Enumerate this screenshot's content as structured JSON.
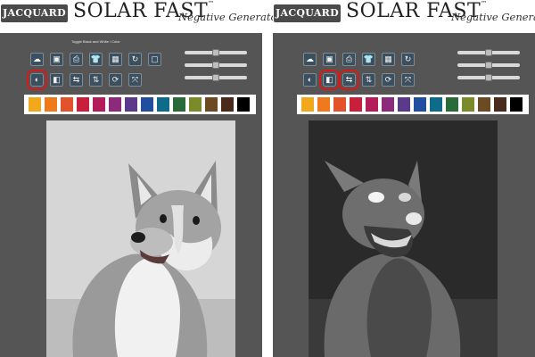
{
  "brand": {
    "logo_text": "JACQUARD",
    "title": "SOLAR FAST",
    "title_tm": "™",
    "subtitle": "Negative Generator"
  },
  "left_panel": {
    "toolbar_caption": "Toggle Black and White / Color",
    "tools_row1": [
      {
        "name": "upload-icon",
        "glyph": "☁"
      },
      {
        "name": "save-icon",
        "glyph": "▣"
      },
      {
        "name": "print-icon",
        "glyph": "⎙"
      },
      {
        "name": "shirt-icon",
        "glyph": "👕"
      },
      {
        "name": "grid-icon",
        "glyph": "▦"
      },
      {
        "name": "reset-icon",
        "glyph": "↻"
      },
      {
        "name": "crop-icon",
        "glyph": "▢"
      }
    ],
    "tools_row2": [
      {
        "name": "bw-color-toggle-icon",
        "glyph": "◐"
      },
      {
        "name": "invert-icon",
        "glyph": "◧"
      },
      {
        "name": "flip-horizontal-icon",
        "glyph": "⇆"
      },
      {
        "name": "flip-vertical-icon",
        "glyph": "⇅"
      },
      {
        "name": "rotate-icon",
        "glyph": "⟳"
      },
      {
        "name": "fit-icon",
        "glyph": "⤧"
      }
    ],
    "highlighted_tools": [
      "bw-color-toggle-icon"
    ],
    "slider_levels": [
      0.5,
      0.5,
      0.5
    ]
  },
  "right_panel": {
    "tools_row1": [
      {
        "name": "upload-icon",
        "glyph": "☁"
      },
      {
        "name": "save-icon",
        "glyph": "▣"
      },
      {
        "name": "print-icon",
        "glyph": "⎙"
      },
      {
        "name": "shirt-icon",
        "glyph": "👕"
      },
      {
        "name": "grid-icon",
        "glyph": "▦"
      },
      {
        "name": "reset-icon",
        "glyph": "↻"
      }
    ],
    "tools_row2": [
      {
        "name": "bw-color-toggle-icon",
        "glyph": "◐"
      },
      {
        "name": "invert-icon",
        "glyph": "◧"
      },
      {
        "name": "flip-horizontal-icon",
        "glyph": "⇆"
      },
      {
        "name": "flip-vertical-icon",
        "glyph": "⇅"
      },
      {
        "name": "rotate-icon",
        "glyph": "⟳"
      },
      {
        "name": "fit-icon",
        "glyph": "⤧"
      }
    ],
    "highlighted_tools": [
      "invert-icon",
      "flip-horizontal-icon"
    ],
    "slider_levels": [
      0.5,
      0.5,
      0.5
    ]
  },
  "swatch_colors": [
    "#f0a81c",
    "#ee7a1c",
    "#e2522b",
    "#c81f3c",
    "#b31d5a",
    "#8c2a7c",
    "#5b3a8c",
    "#1f4f9e",
    "#0f6b8a",
    "#2a6b3a",
    "#7b8a2a",
    "#6b4a24",
    "#4a2a1a",
    "#000000"
  ],
  "colors": {
    "app_background": "#555555",
    "highlight_ring": "#d61a1a",
    "button_fill": "#3b4f5e"
  }
}
